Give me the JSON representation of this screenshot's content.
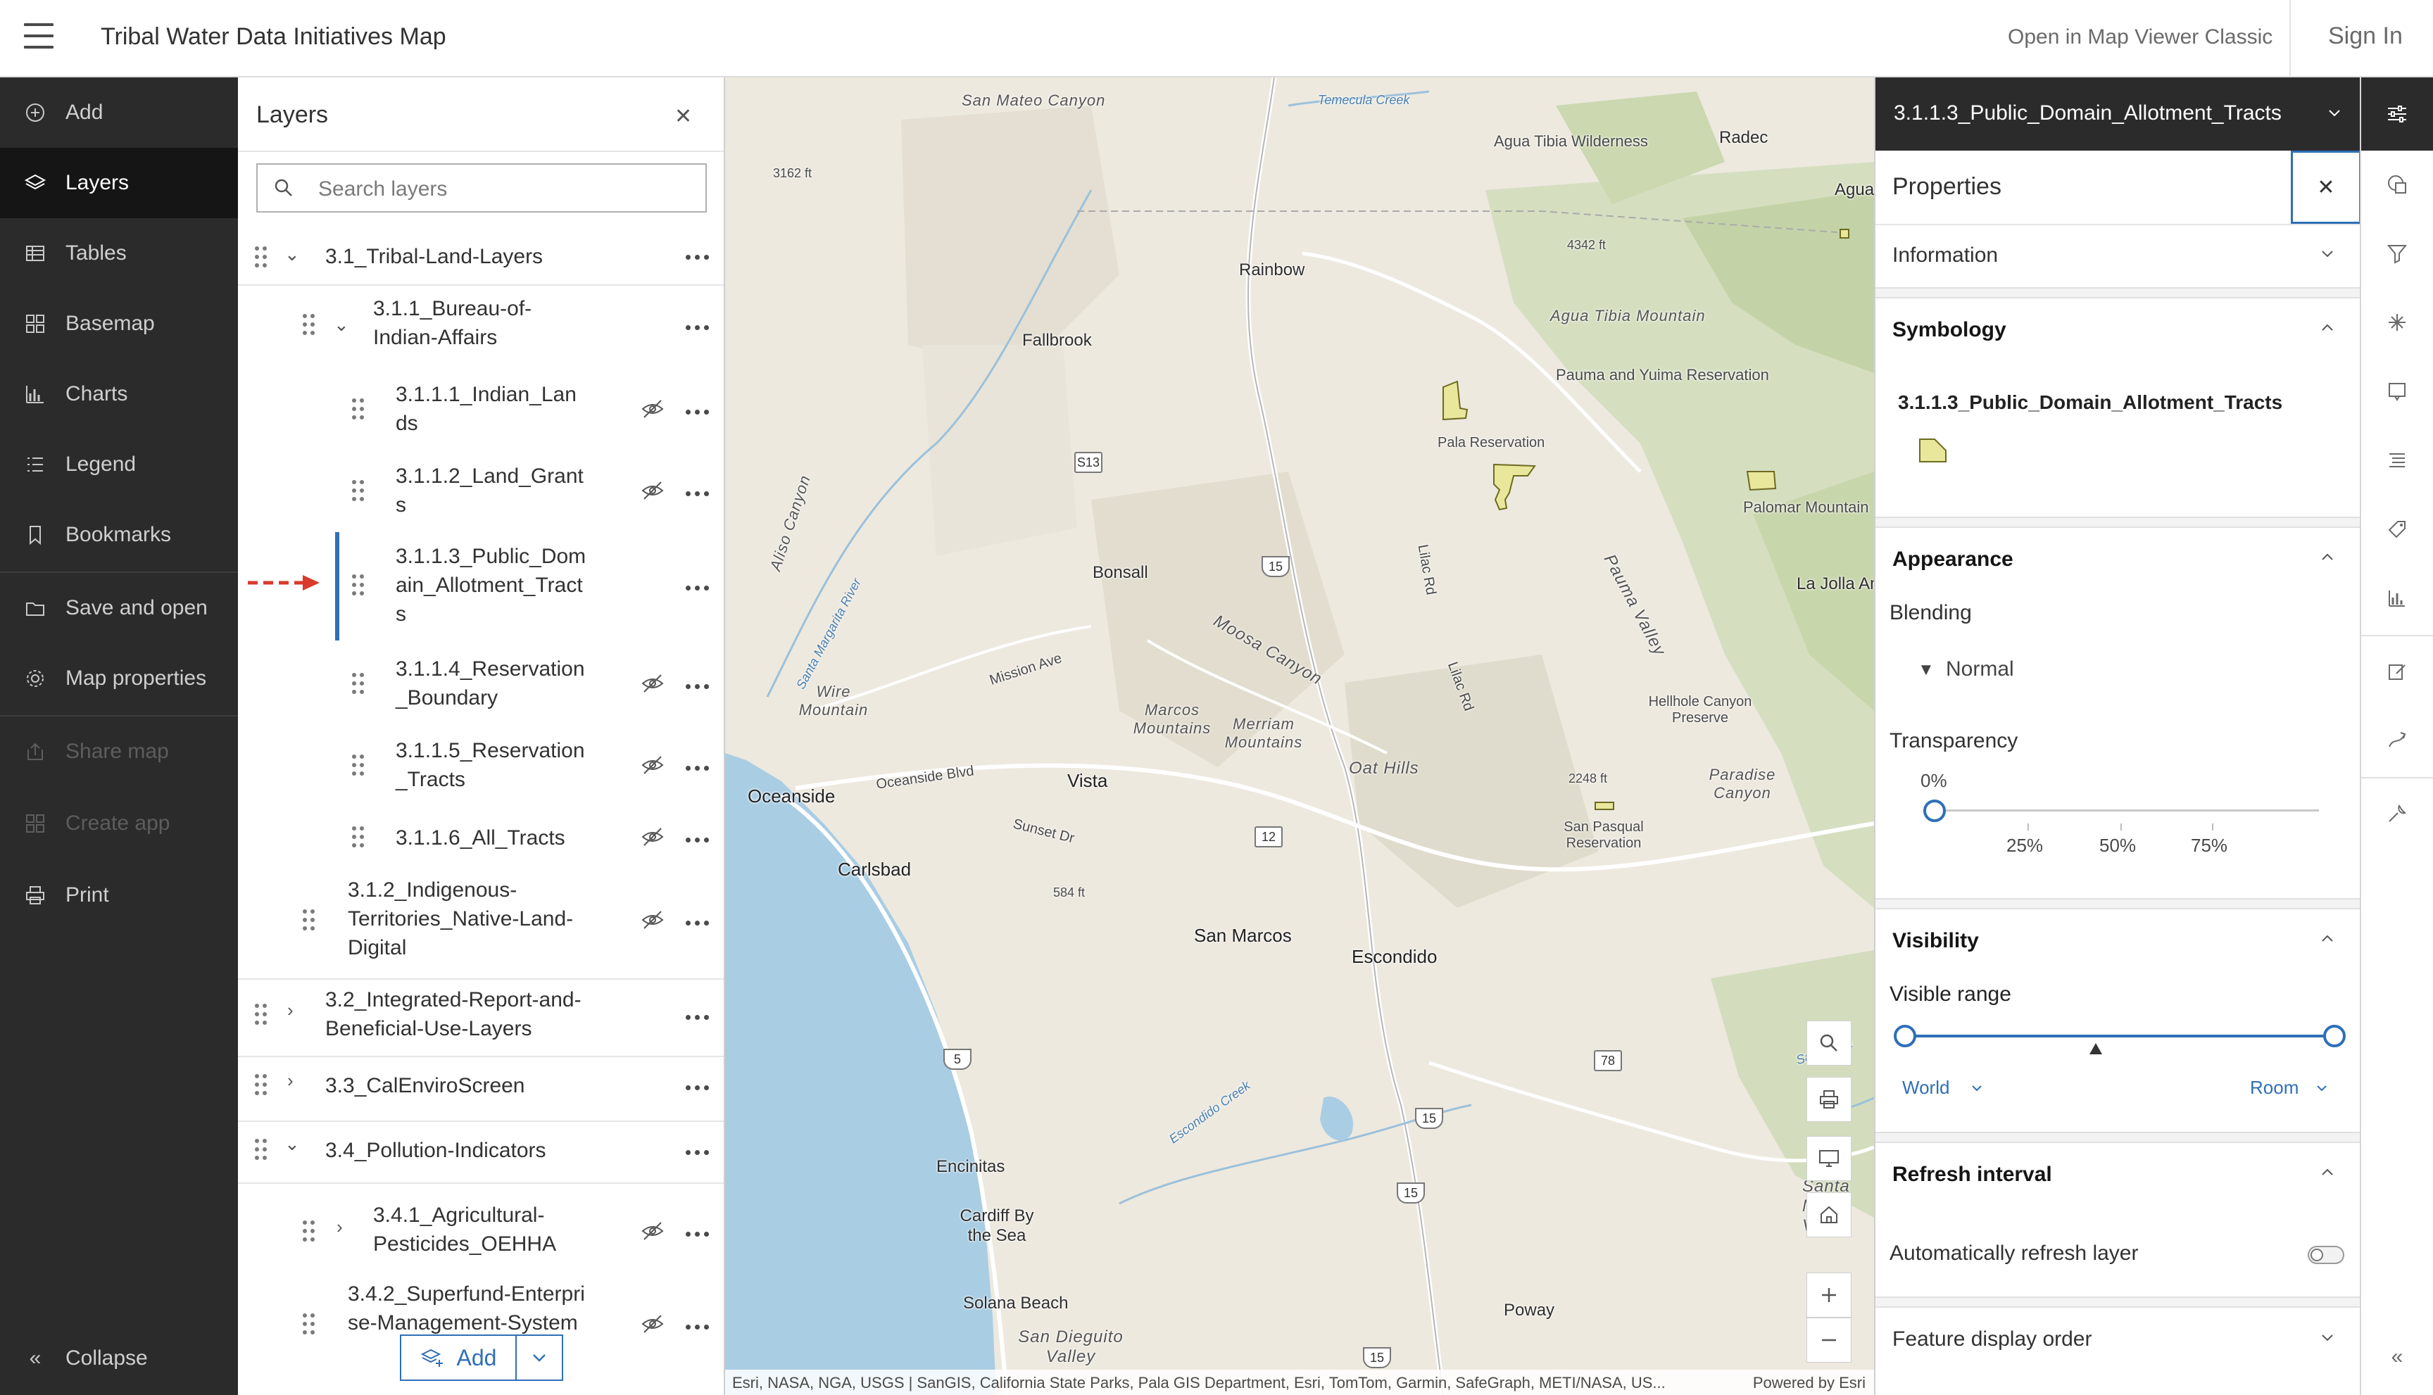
{
  "header": {
    "title": "Tribal Water Data Initiatives Map",
    "open_classic": "Open in Map Viewer Classic",
    "sign_in": "Sign In"
  },
  "nav": {
    "items": [
      {
        "label": "Add",
        "icon": "add-circle-icon"
      },
      {
        "label": "Layers",
        "icon": "layers-icon"
      },
      {
        "label": "Tables",
        "icon": "table-icon"
      },
      {
        "label": "Basemap",
        "icon": "basemap-icon"
      },
      {
        "label": "Charts",
        "icon": "chart-icon"
      },
      {
        "label": "Legend",
        "icon": "legend-icon"
      },
      {
        "label": "Bookmarks",
        "icon": "bookmark-icon"
      },
      {
        "label": "Save and open",
        "icon": "folder-icon"
      },
      {
        "label": "Map properties",
        "icon": "gear-icon"
      },
      {
        "label": "Share map",
        "icon": "share-icon"
      },
      {
        "label": "Create app",
        "icon": "apps-icon"
      },
      {
        "label": "Print",
        "icon": "print-icon"
      }
    ],
    "collapse": "Collapse"
  },
  "layers": {
    "title": "Layers",
    "search_placeholder": "Search layers",
    "rows": [
      {
        "label": "3.1_Tribal-Land-Layers"
      },
      {
        "label": "3.1.1_Bureau-of-Indian-Affairs"
      },
      {
        "label": "3.1.1.1_Indian_Lands"
      },
      {
        "label": "3.1.1.2_Land_Grants"
      },
      {
        "label": "3.1.1.3_Public_Domain_Allotment_Tracts"
      },
      {
        "label": "3.1.1.4_Reservation_Boundary"
      },
      {
        "label": "3.1.1.5_Reservation_Tracts"
      },
      {
        "label": "3.1.1.6_All_Tracts"
      },
      {
        "label": "3.1.2_Indigenous-Territories_Native-Land-Digital"
      },
      {
        "label": "3.2_Integrated-Report-and-Beneficial-Use-Layers"
      },
      {
        "label": "3.3_CalEnviroScreen"
      },
      {
        "label": "3.4_Pollution-Indicators"
      },
      {
        "label": "3.4.1_Agricultural-Pesticides_OEHHA"
      },
      {
        "label": "3.4.2_Superfund-Enterprise-Management-System"
      }
    ],
    "add_button": "Add"
  },
  "map": {
    "labels": {
      "san_mateo_canyon": "San Mateo Canyon",
      "temecula_creek": "Temecula Creek",
      "agua_tibia_wilderness": "Agua Tibia Wilderness",
      "radec": "Radec",
      "aguanga": "Aguan",
      "elev_3162": "3162 ft",
      "elev_4342": "4342 ft",
      "rainbow": "Rainbow",
      "agua_tibia_mountain": "Agua Tibia Mountain",
      "pauma_yuima": "Pauma and Yuima Reservation",
      "fallbrook": "Fallbrook",
      "aliso_canyon": "Aliso Canyon",
      "santa_margarita": "Santa Margarita River",
      "pala_reservation": "Pala Reservation",
      "palomar_mountain": "Palomar Mountain",
      "lilac_rd": "Lilac Rd",
      "bonsall": "Bonsall",
      "pauma_valley": "Pauma Valley",
      "la_jolla_amago": "La Jolla Am",
      "moosa_canyon": "Moosa Canyon",
      "mission_ave": "Mission Ave",
      "lilac_rd2": "Lilac Rd",
      "wire_mountain": "Wire Mountain",
      "marcos_mountains": "Marcos Mountains",
      "merriam_mountains": "Merriam Mountains",
      "hellhole": "Hellhole Canyon Preserve",
      "oceanside": "Oceanside",
      "vista": "Vista",
      "oat_hills": "Oat Hills",
      "oceanside_blvd": "Oceanside Blvd",
      "elev_2248": "2248 ft",
      "paradise_canyon": "Paradise Canyon",
      "san_pasqual": "San Pasqual Reservation",
      "sunset_dr": "Sunset Dr",
      "carlsbad": "Carlsbad",
      "elev_584": "584 ft",
      "san_marcos": "San Marcos",
      "escondido": "Escondido",
      "escondido_creek": "Escondido Creek",
      "santa_ysabel": "Santa Ysa",
      "encinitas": "Encinitas",
      "cardiff": "Cardiff By the Sea",
      "santa_maria_valley": "Santa Maria Valle",
      "solana_beach": "Solana Beach",
      "poway": "Poway",
      "san_dieguito_valley": "San Dieguito Valley"
    },
    "shields": {
      "s13": "S13",
      "i15a": "15",
      "r12": "12",
      "r5": "5",
      "r78": "78",
      "i15b": "15",
      "i15c": "15",
      "i15d": "15"
    },
    "attribution": "Esri, NASA, NGA, USGS | SanGIS, California State Parks, Pala GIS Department, Esri, TomTom, Garmin, SafeGraph, METI/NASA, US...",
    "powered_by": "Powered by Esri"
  },
  "properties": {
    "selected_layer": "3.1.1.3_Public_Domain_Allotment_Tracts",
    "title": "Properties",
    "sections": {
      "information": "Information",
      "symbology": "Symbology",
      "appearance": "Appearance",
      "visibility": "Visibility",
      "refresh": "Refresh interval",
      "feature_order": "Feature display order"
    },
    "symbology_layer": "3.1.1.3_Public_Domain_Allotment_Tracts",
    "symbol_color": "#e8e79c",
    "blending_label": "Blending",
    "blending_value": "Normal",
    "transparency_label": "Transparency",
    "transparency_value": "0%",
    "transparency_ticks": [
      "25%",
      "50%",
      "75%"
    ],
    "visible_range_label": "Visible range",
    "range_min": "World",
    "range_max": "Room",
    "auto_refresh_label": "Automatically refresh layer",
    "auto_refresh_on": false
  },
  "colors": {
    "accent": "#2f6fb7",
    "nav_bg": "#2b2b2b",
    "feature_fill": "#e8e79c",
    "arrow": "#d93a2b"
  }
}
